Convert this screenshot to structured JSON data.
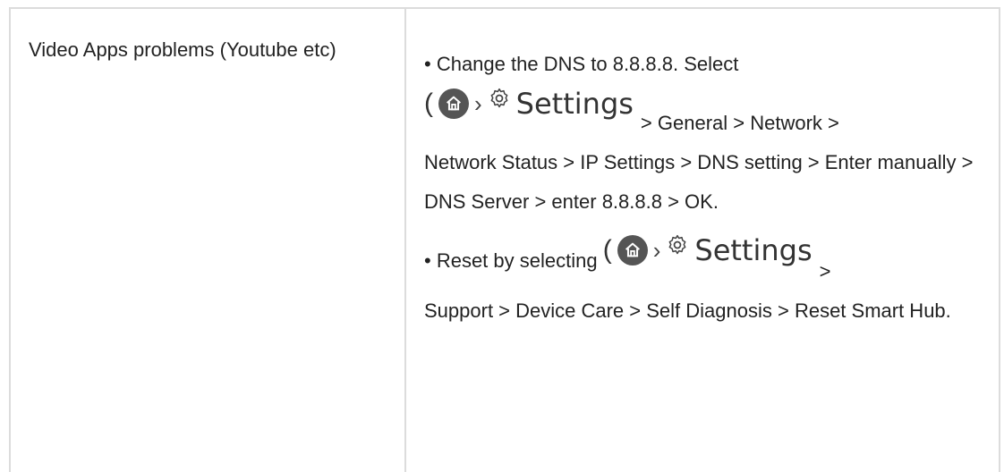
{
  "row": {
    "problem": "Video Apps problems (Youtube etc)",
    "solution_1": {
      "intro": "• Change the DNS to 8.8.8.8. Select",
      "menu_word": "Settings",
      "after_menu": "> General > Network >",
      "rest": "Network Status > IP Settings > DNS setting > Enter manually > DNS Server > enter 8.8.8.8 > OK."
    },
    "solution_2": {
      "intro": "• Reset by selecting",
      "menu_word": "Settings",
      "after_menu": ">",
      "rest": "Support > Device Care > Self Diagnosis > Reset Smart Hub."
    }
  },
  "icons": [
    "home-icon",
    "chevron-right-icon",
    "gear-icon"
  ],
  "colors": {
    "border": "#dcdcdc",
    "text": "#222222",
    "home_button": "#555555"
  }
}
